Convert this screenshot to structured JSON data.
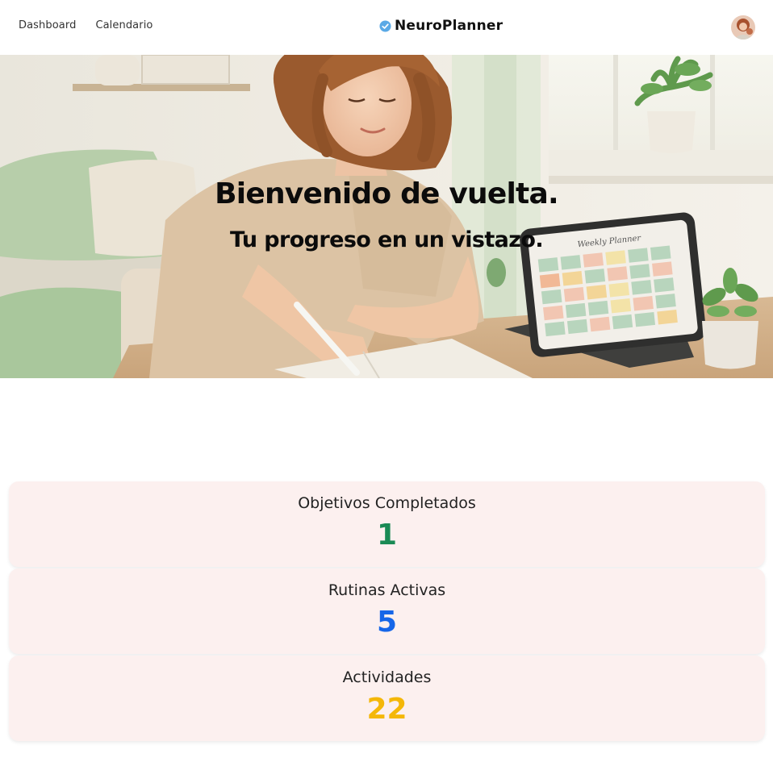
{
  "nav": {
    "links": [
      "Dashboard",
      "Calendario"
    ],
    "brand": "NeuroPlanner",
    "brand_icon": "verified-check-icon",
    "avatar_icon": "user-avatar"
  },
  "hero": {
    "title": "Bienvenido de vuelta.",
    "subtitle": "Tu progreso en un vistazo.",
    "tablet_text": "Weekly Planner"
  },
  "stats": [
    {
      "label": "Objetivos Completados",
      "value": "1",
      "color": "#1a8a55"
    },
    {
      "label": "Rutinas Activas",
      "value": "5",
      "color": "#1666e8"
    },
    {
      "label": "Actividades",
      "value": "22",
      "color": "#f4b708"
    }
  ],
  "colors": {
    "card_bg": "#fcf0ef",
    "brand_check": "#5aa9e6"
  }
}
